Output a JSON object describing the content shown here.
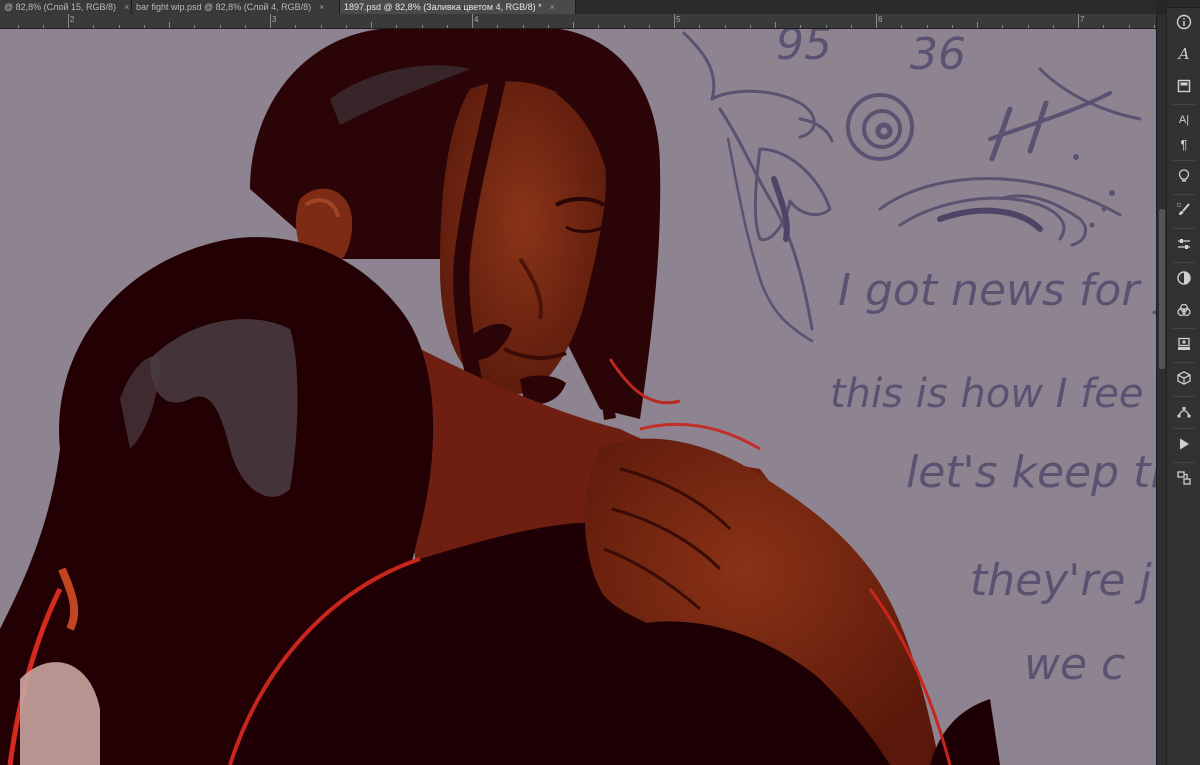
{
  "tabs": [
    {
      "label": "@ 82,8% (Слой 15, RGB/8)",
      "close": "×"
    },
    {
      "label": "bar fight wip.psd @ 82,8% (Слой 4, RGB/8)",
      "close": "×"
    },
    {
      "label": "1897.psd @ 82,8% (Заливка цветом 4, RGB/8) *",
      "close": "×"
    }
  ],
  "ruler": {
    "numbers": [
      "2",
      "3",
      "4",
      "5",
      "6",
      "7"
    ]
  },
  "canvas": {
    "doodle_numbers": [
      "95",
      "36",
      "H."
    ],
    "lyrics": [
      "I got news for y",
      "this is how I fee",
      "let's keep the",
      "they're j",
      "we c"
    ]
  },
  "panel": {
    "icons": [
      "info-icon",
      "glyphs-icon",
      "libraries-icon",
      "character-paragraph-icon",
      "properties-icon",
      "brushes-icon",
      "adjustments-icon",
      "styles-icon",
      "channels-icon",
      "layer-comps-icon",
      "3d-icon",
      "paths-icon",
      "actions-icon",
      "timeline-icon"
    ]
  },
  "colors": {
    "canvas_bg": "#8e8390",
    "shadow_maroon": "#260005",
    "skin": "#7a2a14",
    "rim_light": "#d42a20",
    "pencil": "#5b5272"
  }
}
